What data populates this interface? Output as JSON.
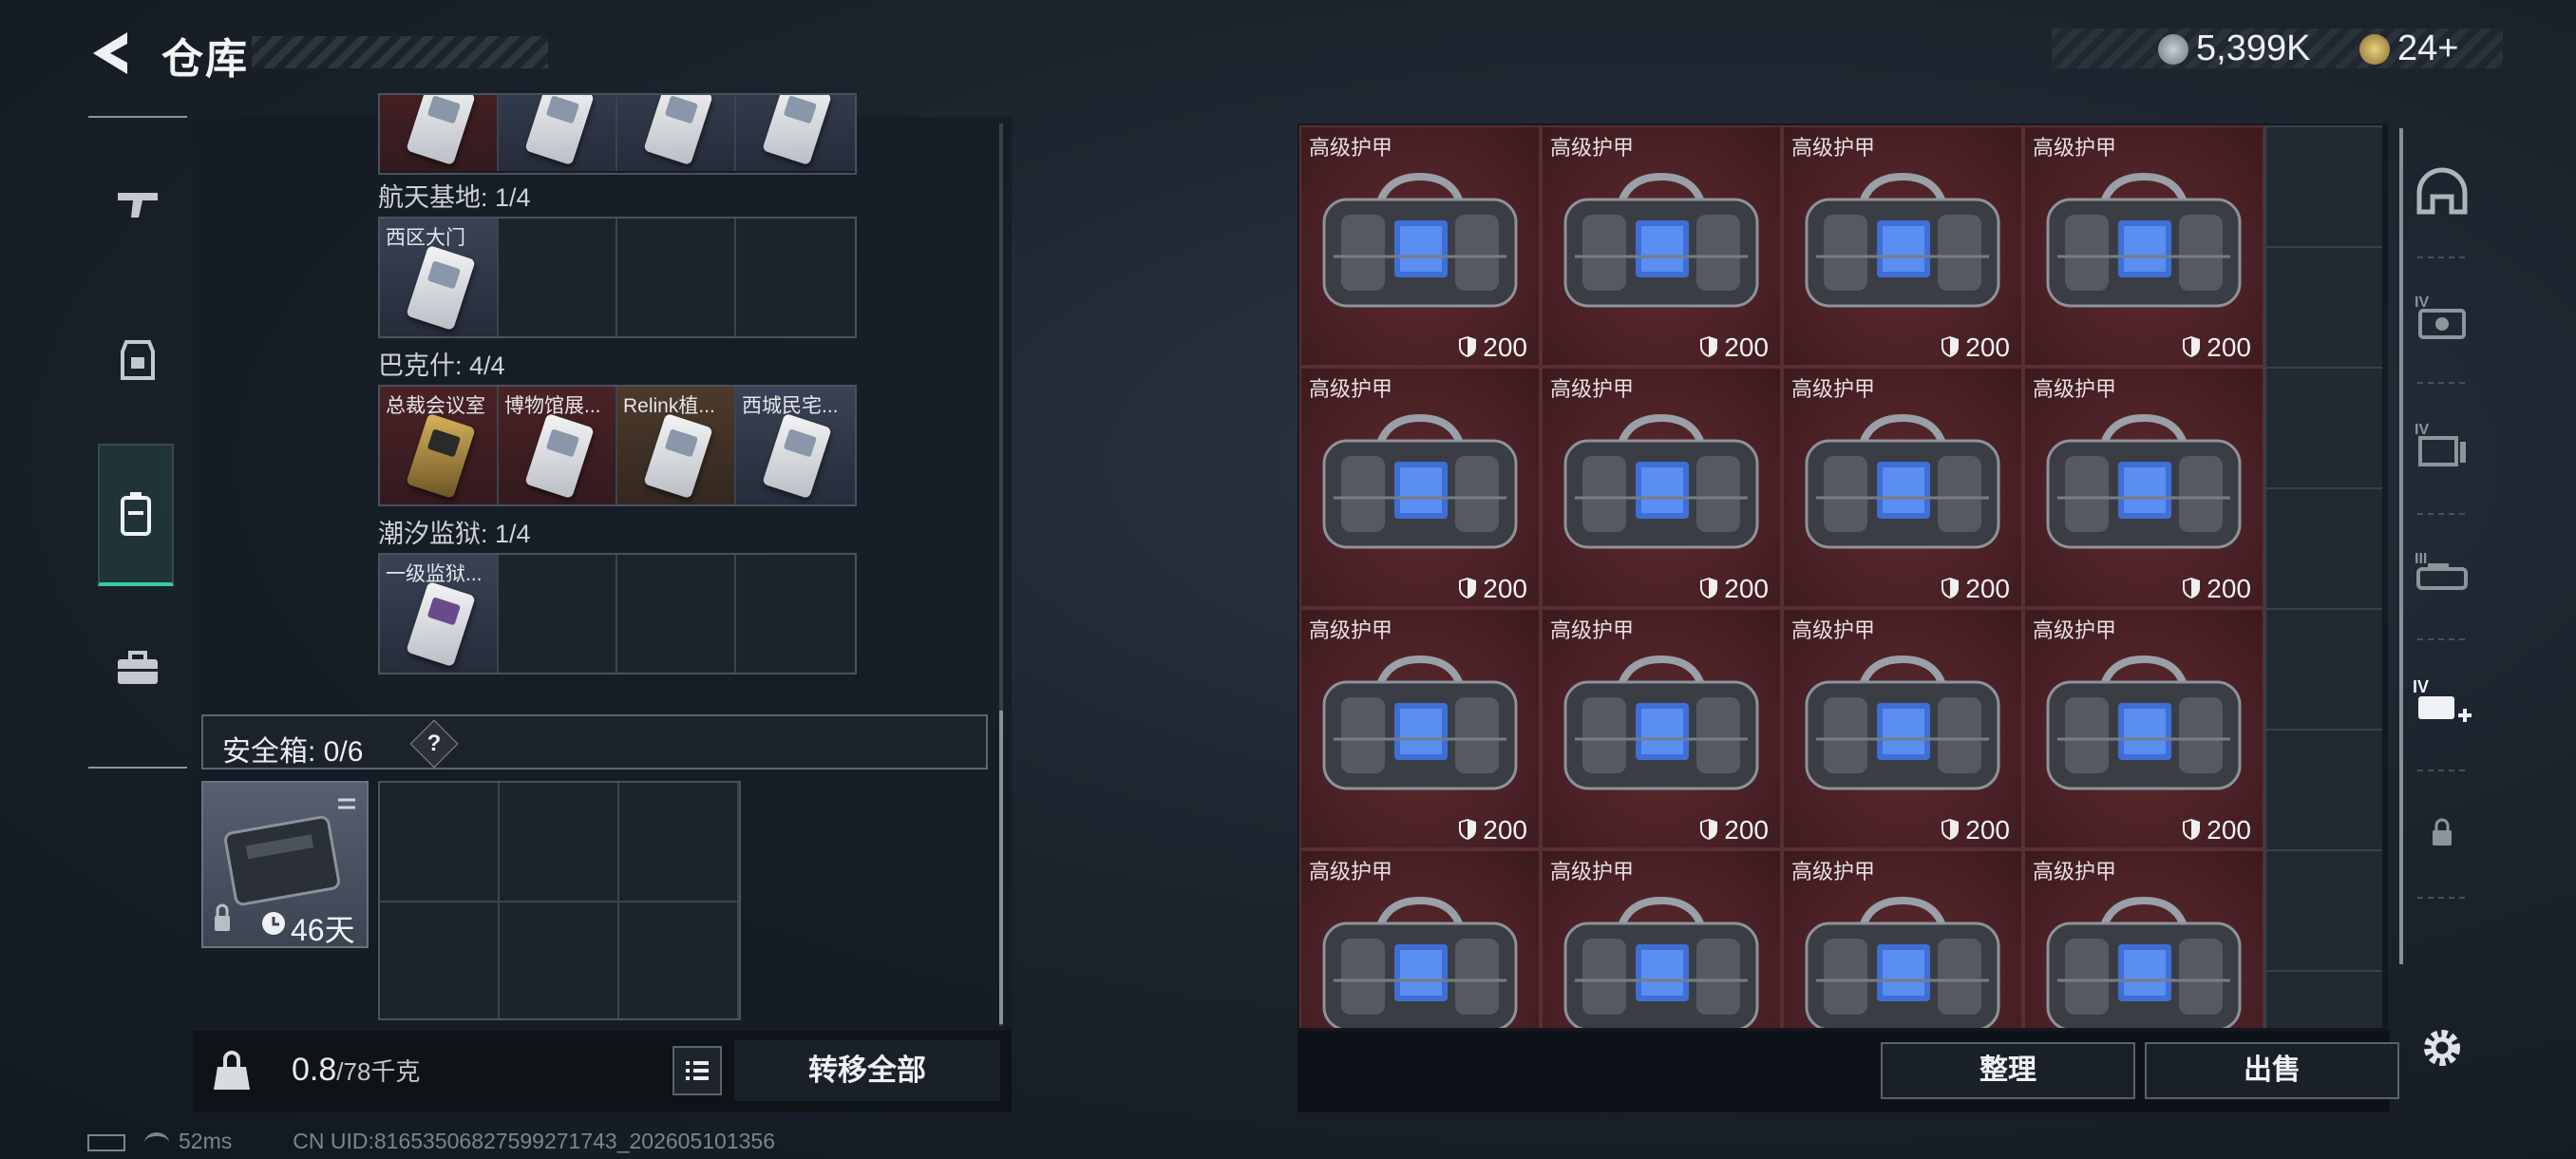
{
  "header": {
    "title": "仓库",
    "currency": [
      {
        "name": "coin-icon",
        "value": "5,399K"
      },
      {
        "name": "token-icon",
        "value": "24+"
      }
    ]
  },
  "nav": [
    {
      "name": "weapon-icon",
      "active": false
    },
    {
      "name": "armor-icon",
      "active": false
    },
    {
      "name": "backpack-icon",
      "active": true
    },
    {
      "name": "toolbox-icon",
      "active": false
    }
  ],
  "left": {
    "groups": [
      {
        "label": "航天基地: 1/4",
        "slots": [
          {
            "name": "西区大门",
            "tone": "blue"
          },
          null,
          null,
          null
        ]
      },
      {
        "label": "巴克什: 4/4",
        "slots": [
          {
            "name": "总裁会议室",
            "tone": "red",
            "gold": true
          },
          {
            "name": "博物馆展...",
            "tone": "red"
          },
          {
            "name": "Relink植...",
            "tone": "brown"
          },
          {
            "name": "西城民宅...",
            "tone": "blue"
          }
        ]
      },
      {
        "label": "潮汐监狱: 1/4",
        "slots": [
          {
            "name": "一级监狱...",
            "tone": "blue"
          },
          null,
          null,
          null
        ]
      }
    ],
    "safe_box": {
      "label": "安全箱: 0/6",
      "help": "?",
      "expiry": "46天"
    },
    "footer": {
      "weight_current": "0.8",
      "weight_max": "/78千克",
      "transfer_label": "转移全部"
    }
  },
  "status": {
    "ping": "52ms",
    "uid": "CN UID:81653506827599271743_202605101356"
  },
  "storage": {
    "item_name": "高级护甲",
    "item_value": "200",
    "rows": 4,
    "cols": 4
  },
  "right_footer": {
    "sort_label": "整理",
    "sell_label": "出售"
  },
  "colors": {
    "accent": "#39c9a6",
    "item_bg": "#4a2126"
  }
}
